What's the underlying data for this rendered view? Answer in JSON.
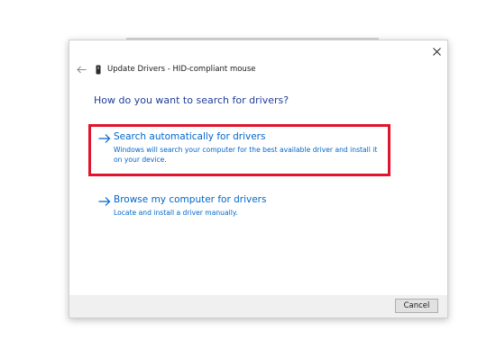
{
  "dialog": {
    "title": "Update Drivers - HID-compliant mouse",
    "question": "How do you want to search for drivers?",
    "options": [
      {
        "title": "Search automatically for drivers",
        "description": "Windows will search your computer for the best available driver and install it on your device.",
        "highlighted": true
      },
      {
        "title": "Browse my computer for drivers",
        "description": "Locate and install a driver manually.",
        "highlighted": false
      }
    ],
    "cancel_label": "Cancel"
  },
  "icons": {
    "close": "close-icon",
    "back": "back-arrow-icon",
    "device": "mouse-device-icon",
    "option_arrow": "arrow-right-icon"
  },
  "colors": {
    "question": "#1f3d99",
    "link": "#0066cc",
    "highlight": "#e0142c",
    "footer": "#f0f0f0"
  }
}
